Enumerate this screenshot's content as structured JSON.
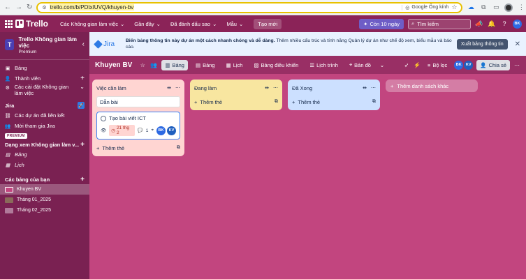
{
  "browser": {
    "url": "trello.com/b/PDtxIUVQ/khuyen-bv",
    "translate_chip": "Google Ống kính"
  },
  "header": {
    "brand": "Trello",
    "menus": [
      "Các Không gian làm việc",
      "Gần đây",
      "Đã đánh dấu sao",
      "Mẫu"
    ],
    "create_label": "Tạo mới",
    "trial_label": "Còn 10 ngày",
    "search_placeholder": "Tìm kiếm",
    "user_initials": "BK"
  },
  "sidebar": {
    "workspace_initial": "T",
    "workspace_name": "Trello Không gian làm việc",
    "workspace_plan": "Premium",
    "items": [
      {
        "label": "Bảng",
        "icon": "board-icon"
      },
      {
        "label": "Thành viên",
        "icon": "member-icon"
      },
      {
        "label": "Các cài đặt Không gian làm việc",
        "icon": "gear-icon"
      }
    ],
    "jira_section": "Jira",
    "jira_items": [
      {
        "label": "Các dự án đã liên kết",
        "icon": "link-icon"
      },
      {
        "label": "Mời tham gia Jira",
        "icon": "person-add-icon"
      }
    ],
    "premium_tag": "PREMIUM",
    "views_section": "Dạng xem Không gian làm v...",
    "view_items": [
      {
        "label": "Bảng",
        "icon": "table-icon"
      },
      {
        "label": "Lịch",
        "icon": "calendar-icon"
      }
    ],
    "boards_section": "Các bảng của bạn",
    "boards": [
      {
        "label": "Khuyen BV",
        "color": "#c2457f",
        "active": true
      },
      {
        "label": "Tháng 01_2025",
        "color": "#8a6a5a",
        "active": false
      },
      {
        "label": "Tháng 02_2025",
        "color": "#b07a9a",
        "active": false
      }
    ]
  },
  "banner": {
    "logo_text": "Jira",
    "bold_text": "Biến bảng thông tin này dự án một cách nhanh chóng và dễ dàng.",
    "text": " Thêm nhiều cấu trúc và tính năng Quản lý dự án như chế độ xem, biểu mẫu và báo cáo.",
    "button_label": "Xuất bảng thông tin"
  },
  "board": {
    "title": "Khuyen BV",
    "views": [
      {
        "label": "Bảng",
        "active": true
      },
      {
        "label": "Bảng",
        "active": false
      },
      {
        "label": "Lịch",
        "active": false
      },
      {
        "label": "Bảng điều khiển",
        "active": false
      },
      {
        "label": "Lịch trình",
        "active": false
      },
      {
        "label": "Bản đồ",
        "active": false
      }
    ],
    "filter_label": "Bộ lọc",
    "members": [
      {
        "initials": "BK",
        "color": "#2d6ae3"
      },
      {
        "initials": "KV",
        "color": "#1f5fbf"
      }
    ],
    "share_label": "Chia sẻ"
  },
  "lists": [
    {
      "title": "Việc cần làm",
      "bg": "#ffd5d2",
      "input_value": "Dẫn bài",
      "cards": [
        {
          "title": "Tạo bài viết ICT",
          "due": "21 thg 2",
          "comments": "1",
          "members": [
            "BK",
            "KV"
          ]
        }
      ],
      "add_label": "Thêm thẻ"
    },
    {
      "title": "Đang làm",
      "bg": "#f8e6a0",
      "cards": [],
      "add_label": "Thêm thẻ"
    },
    {
      "title": "Đã Xong",
      "bg": "#cce0ff",
      "cards": [],
      "add_label": "Thêm thẻ"
    }
  ],
  "add_list_label": "Thêm danh sách khác"
}
